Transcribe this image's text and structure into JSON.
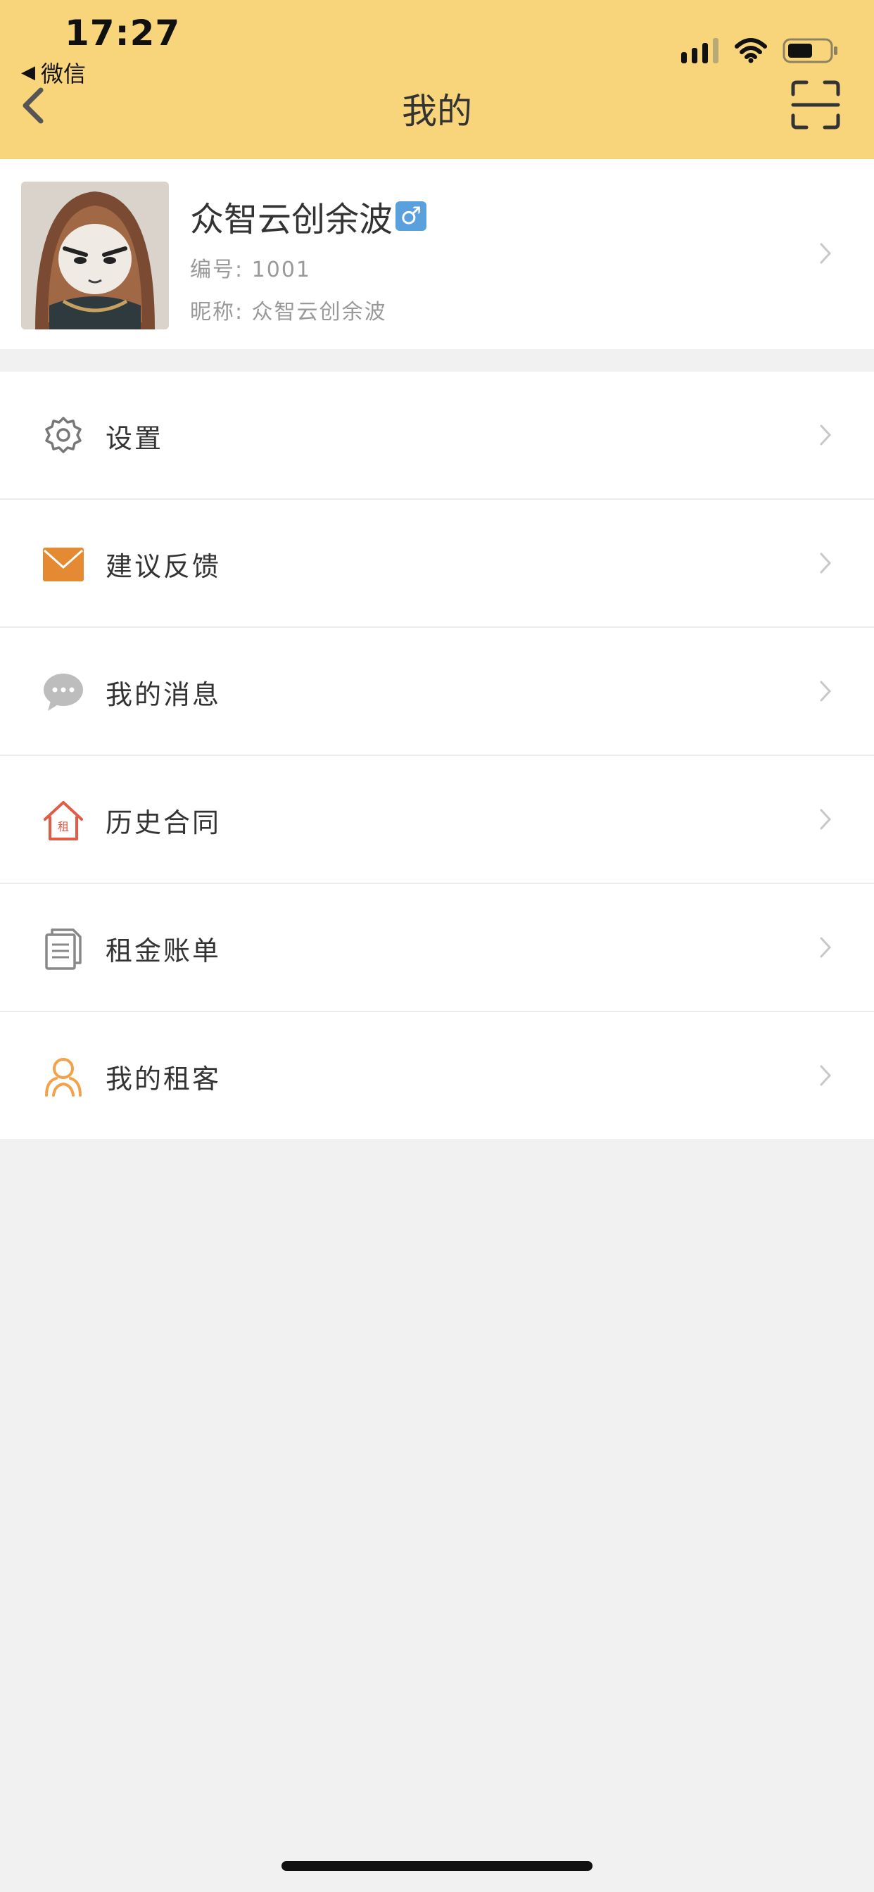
{
  "status_bar": {
    "time": "17:27",
    "back_app": "微信",
    "back_arrow": "◀"
  },
  "nav": {
    "title": "我的"
  },
  "profile": {
    "name": "众智云创余波",
    "gender_symbol": "♂",
    "id_line": "编号: 1001",
    "nick_line": "昵称: 众智云创余波"
  },
  "menu": {
    "items": [
      {
        "label": "设置",
        "icon": "gear-icon"
      },
      {
        "label": "建议反馈",
        "icon": "mail-icon"
      },
      {
        "label": "我的消息",
        "icon": "chat-bubble-icon"
      },
      {
        "label": "历史合同",
        "icon": "house-rent-icon"
      },
      {
        "label": "租金账单",
        "icon": "document-icon"
      },
      {
        "label": "我的租客",
        "icon": "tenant-icon"
      }
    ]
  },
  "house_icon_char": "租",
  "colors": {
    "header_bg": "#f8d57a",
    "page_bg": "#f1f1f1",
    "mail_orange": "#e38a33",
    "house_red": "#e25b45",
    "tenant_orange": "#f3a24a",
    "gender_blue": "#5aa0dc"
  }
}
